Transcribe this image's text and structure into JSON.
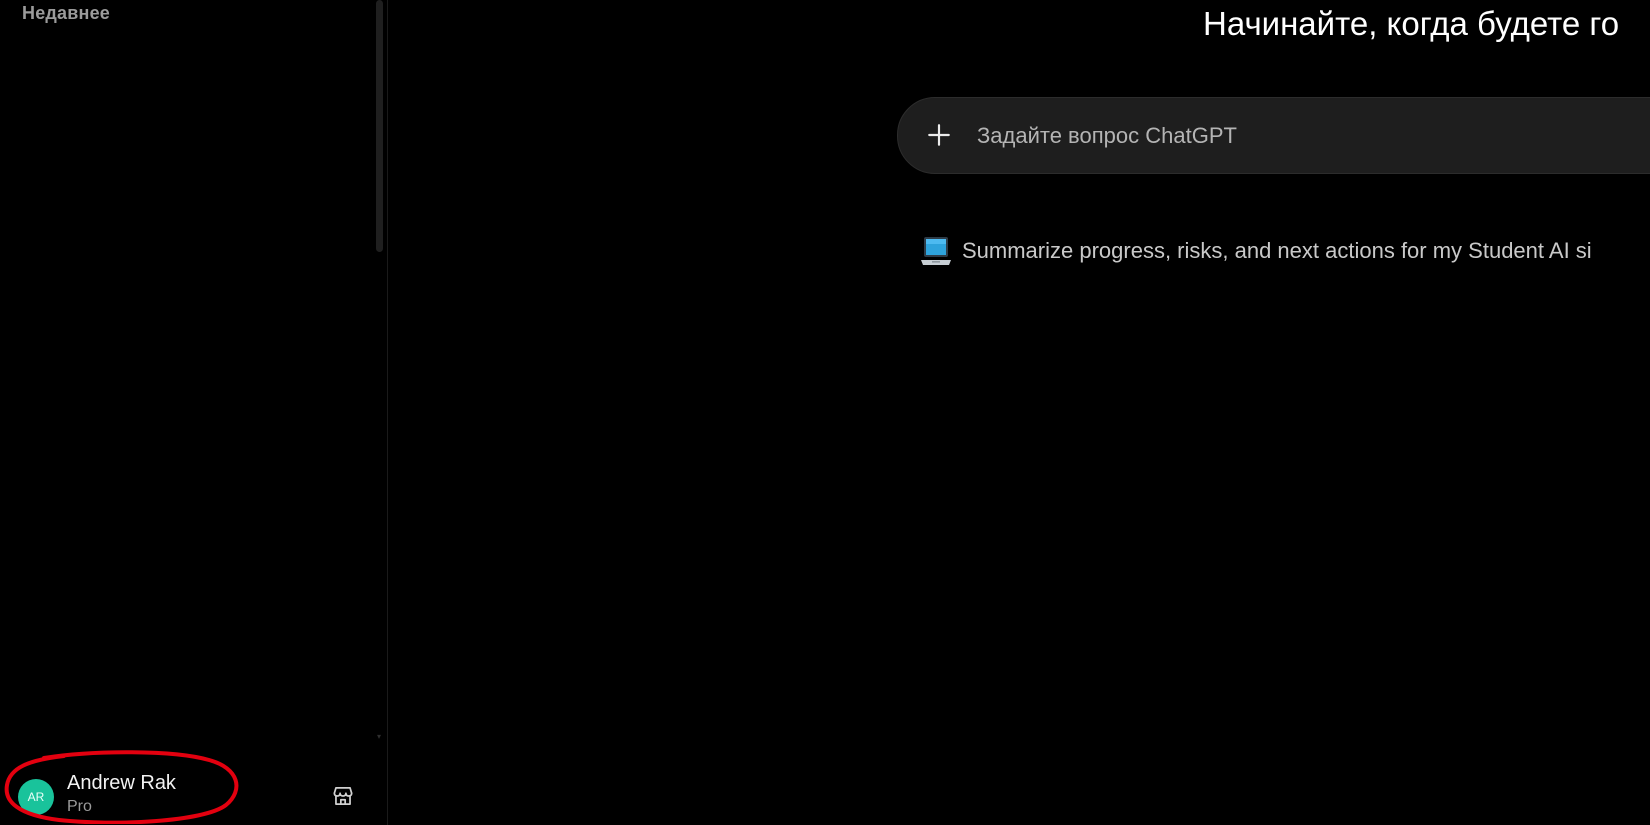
{
  "sidebar": {
    "recent_heading": "Недавнее",
    "scroll_down_arrow": "▾",
    "user": {
      "initials": "AR",
      "name": "Andrew Rak",
      "plan": "Pro",
      "avatar_color": "#19c39b"
    },
    "store_icon": "store-icon"
  },
  "main": {
    "headline": "Начинайте, когда будете го",
    "composer": {
      "placeholder": "Задайте вопрос ChatGPT",
      "plus_icon": "plus-icon"
    },
    "suggestion": {
      "icon": "laptop-icon",
      "text": "Summarize progress, risks, and next actions for my Student AI si"
    }
  },
  "annotation": {
    "color": "#e3000f",
    "shape": "hand-drawn ellipse around user profile"
  }
}
